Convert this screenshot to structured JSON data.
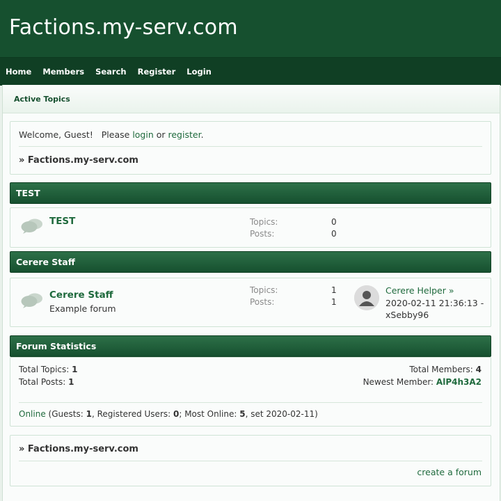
{
  "site": {
    "title": "Factions.my-serv.com"
  },
  "nav": [
    "Home",
    "Members",
    "Search",
    "Register",
    "Login"
  ],
  "breadcrumb": {
    "active_topics": "Active Topics"
  },
  "welcome": {
    "text_prefix": "Welcome, Guest!   Please ",
    "login": "login",
    "or": " or ",
    "register": "register",
    "period": ".",
    "forum_path": "» Factions.my-serv.com"
  },
  "categories": [
    {
      "header": "TEST",
      "forum": {
        "name": "TEST",
        "description": "",
        "topics_label": "Topics:",
        "topics": "0",
        "posts_label": "Posts:",
        "posts": "0"
      }
    },
    {
      "header": "Cerere Staff",
      "forum": {
        "name": "Cerere Staff",
        "description": "Example forum",
        "topics_label": "Topics:",
        "topics": "1",
        "posts_label": "Posts:",
        "posts": "1",
        "last_post_title": "Cerere Helper",
        "last_post_arrow": "»",
        "last_post_date": "2020-02-11 21:36:13 -",
        "last_post_user": "xSebby96"
      }
    }
  ],
  "statistics": {
    "header": "Forum Statistics",
    "total_topics_label": "Total Topics: ",
    "total_topics": "1",
    "total_posts_label": "Total Posts: ",
    "total_posts": "1",
    "total_members_label": "Total Members: ",
    "total_members": "4",
    "newest_member_label": "Newest Member: ",
    "newest_member": "AlP4h3A2",
    "online_link": "Online",
    "online_guests_label": " (Guests: ",
    "online_guests": "1",
    "online_registered_label": ", Registered Users: ",
    "online_registered": "0",
    "online_most_label": "; Most Online: ",
    "online_most": "5",
    "online_set": ", set 2020-02-11)"
  },
  "footer": {
    "forum_path": "» Factions.my-serv.com",
    "create_forum": "create a forum"
  },
  "colors": {
    "header_bg": "#16502f",
    "nav_bg": "#103f24",
    "link": "#1f6a3d"
  },
  "icons": {
    "forum": "speech-bubbles-icon",
    "avatar": "default-user-avatar-icon"
  }
}
